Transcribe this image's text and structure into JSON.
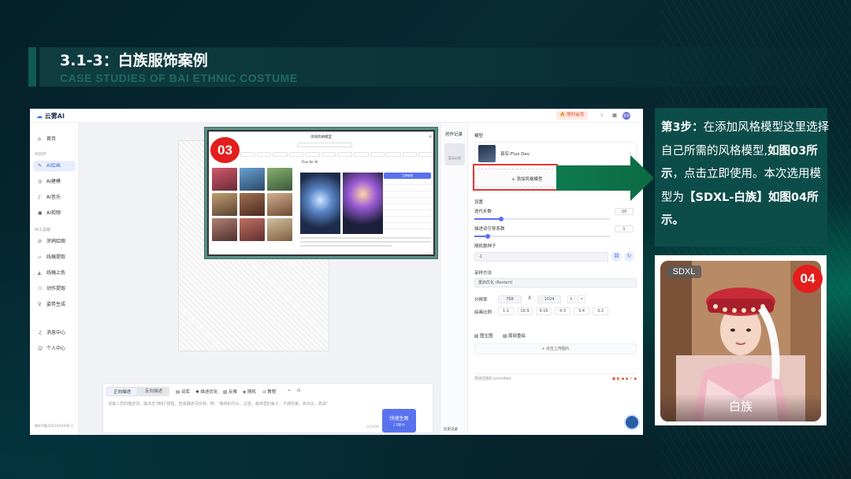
{
  "slide": {
    "title": "3.1-3：白族服饰案例",
    "subtitle": "CASE STUDIES OF BAI ETHNIC COSTUME"
  },
  "app": {
    "logo": "云雾AI",
    "top_badge": "🔥 限时会员",
    "avatar_text": "登录",
    "sidebar": {
      "home": "首页",
      "section_ai": "AI创作",
      "items": [
        "AI绘画",
        "AI建模",
        "AI音乐",
        "AI视频"
      ],
      "section_tools": "AI工具箱",
      "tools": [
        "涂鸦绘图",
        "线稿提取",
        "线稿上色",
        "动作提取",
        "姿势生成"
      ],
      "bottom": [
        "消息中心",
        "个人中心"
      ],
      "footer": "闽ICP备2023XXXX号-1"
    },
    "history": {
      "title": "创作记录",
      "thumb_label": "暂无记录",
      "footer": "历史记录"
    },
    "prompt": {
      "tab_forward": "正向描述",
      "tab_reverse": "反向描述",
      "tools": [
        "词库",
        "描述优化",
        "反推",
        "随机",
        "教程"
      ],
      "placeholder": "请输入您的描述词，或点击\"随机\"按钮，查看描述词示例。例：\"森林的尽头，古迹，森林里的兔子，卡通风格，高对比，高清\"",
      "count": "0/1000",
      "generate": "快速生图",
      "generate_sub": "12算力",
      "note": "本次需消耗算力"
    },
    "panel": {
      "model_label": "模型",
      "model_name": "真实-Flux Dev",
      "add_model": "添加风格模型",
      "settings_label": "设置",
      "steps_label": "迭代步数",
      "steps_value": "20",
      "steps_fill": 0.2,
      "cfg_label": "描述词引导系数",
      "cfg_value": "1",
      "cfg_fill": 0.1,
      "seed_label": "随机数种子",
      "seed_value": "-1",
      "sampler_label": "采样方法",
      "sampler_value": "重启优化 (Restart)",
      "resolution_label": "分辨率",
      "width": "768",
      "height": "1024",
      "x": "X",
      "ratio_label": "绘画比例",
      "ratios": [
        "1:1",
        "16:9",
        "9:16",
        "4:3",
        "3:4",
        "3:2"
      ],
      "ref_tab1": "图生图",
      "ref_tab2": "局部重绘",
      "upload": "+ 点击上传图片",
      "controlnet": "高级控制ControlNet"
    },
    "popup": {
      "title": "添加风格模型",
      "model_name": "Flux for AI",
      "use_button": "立即使用"
    }
  },
  "badges": {
    "step3": "03",
    "step4": "04"
  },
  "step_text": {
    "part1_bold": "第3步：",
    "part1": "在添加风格模型这里选择自己所需的风格模型,",
    "part2_bold": "如图03所示",
    "part2": "，点击立即使用。本次选用模型为",
    "part3_bold": "【SDXL-白族】如图04所示。"
  },
  "card": {
    "tag": "SDXL",
    "caption": "白族"
  },
  "colors": {
    "accent": "#0d4d49",
    "badge_red": "#e41d1d",
    "primary_blue": "#5b72f0",
    "highlight_red": "#e53935",
    "arrow_green": "#0f7a4e"
  }
}
